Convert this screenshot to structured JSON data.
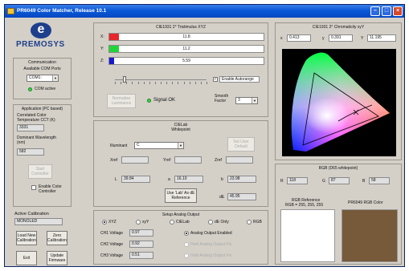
{
  "window": {
    "title": "PR6049 Color Matcher, Release 10.1"
  },
  "brand": {
    "name": "PREMOSYS",
    "logo_letter": "e"
  },
  "communication": {
    "title": "Communication",
    "ports_label": "Available COM Ports",
    "port_value": "COM1:",
    "status": "COM active"
  },
  "application": {
    "title": "Application (PC based)",
    "cct_label": "Correlated Color Temperature CCT (K)",
    "cct_value": "3331",
    "dominant_label": "Dominant Wavelength (nm)",
    "dominant_value": "582",
    "start_controller": "Start Controller",
    "enable_controller": "Enable Color Controller"
  },
  "active_calibration": {
    "title": "Active Calibration",
    "value": "MONOLED"
  },
  "buttons": {
    "load_new": "Load New Calibration",
    "zero": "Zero Calibration",
    "exit": "Exit",
    "update": "Update Firmware"
  },
  "xyz": {
    "title": "CIE1931 2° Tristimulus XYZ",
    "x_label": "X:",
    "x_value": "11.8",
    "y_label": "Y:",
    "y_value": "11.2",
    "z_label": "Z:",
    "z_value": "5.59",
    "x_fill": 0.06,
    "y_fill": 0.06,
    "z_fill": 0.03,
    "autorange_label": "Enable Autorange",
    "normalize_button": "Normalize Luminance",
    "signal_status": "Signal OK",
    "smooth_label": "Smooth Factor",
    "smooth_value": "3",
    "colors": {
      "x": "#e8252a",
      "y": "#22d43a",
      "z": "#1818d0"
    }
  },
  "cielab": {
    "title": "CIELab",
    "subtitle": "Whitepoint",
    "illuminant_label": "Illuminant",
    "illuminant_value": "C",
    "set_default": "Set User Default",
    "xref_label": "Xref",
    "yref_label": "Yref",
    "zref_label": "Zref",
    "l_label": "L",
    "l_value": "39.84",
    "a_label": "a",
    "a_value": "16.10",
    "b_label": "b",
    "b_value": "23.98",
    "use_ref": "Use 'Lab' As dE Reference",
    "de_label": "dE",
    "de_value": "45.95"
  },
  "analog": {
    "title": "Setup Analog Output",
    "opts": [
      "XYZ",
      "xyY",
      "CIELab",
      "dE Only",
      "RGB"
    ],
    "ch1_label": "CH1 Voltage",
    "ch1_value": "0.97",
    "ch2_label": "CH2 Voltage",
    "ch2_value": "0.92",
    "ch3_label": "CH3 Voltage",
    "ch3_value": "0.51",
    "enabled_label": "Analog Output Enabled",
    "hold1_label": "Hold Analog Output Fix",
    "hold2_label": "Hold Analog Output Fix"
  },
  "chromaticity": {
    "title": "CIE1931 2° Chromaticity xyY",
    "x_label": "x",
    "x_value": "0.413",
    "y_label": "y",
    "y_value": "0.391",
    "Y_label": "Y",
    "Y_value": "11.195"
  },
  "rgb": {
    "title": "RGB (D65 whitepoint)",
    "r_label": "R",
    "r_value": "118",
    "g_label": "G",
    "g_value": "87",
    "b_label": "B",
    "b_value": "58",
    "ref_title": "RGB Reference",
    "ref_value": "RGB = 255, 255, 255",
    "color_title": "PR6049 RGB Color",
    "swatch_color": "#765a3a"
  }
}
